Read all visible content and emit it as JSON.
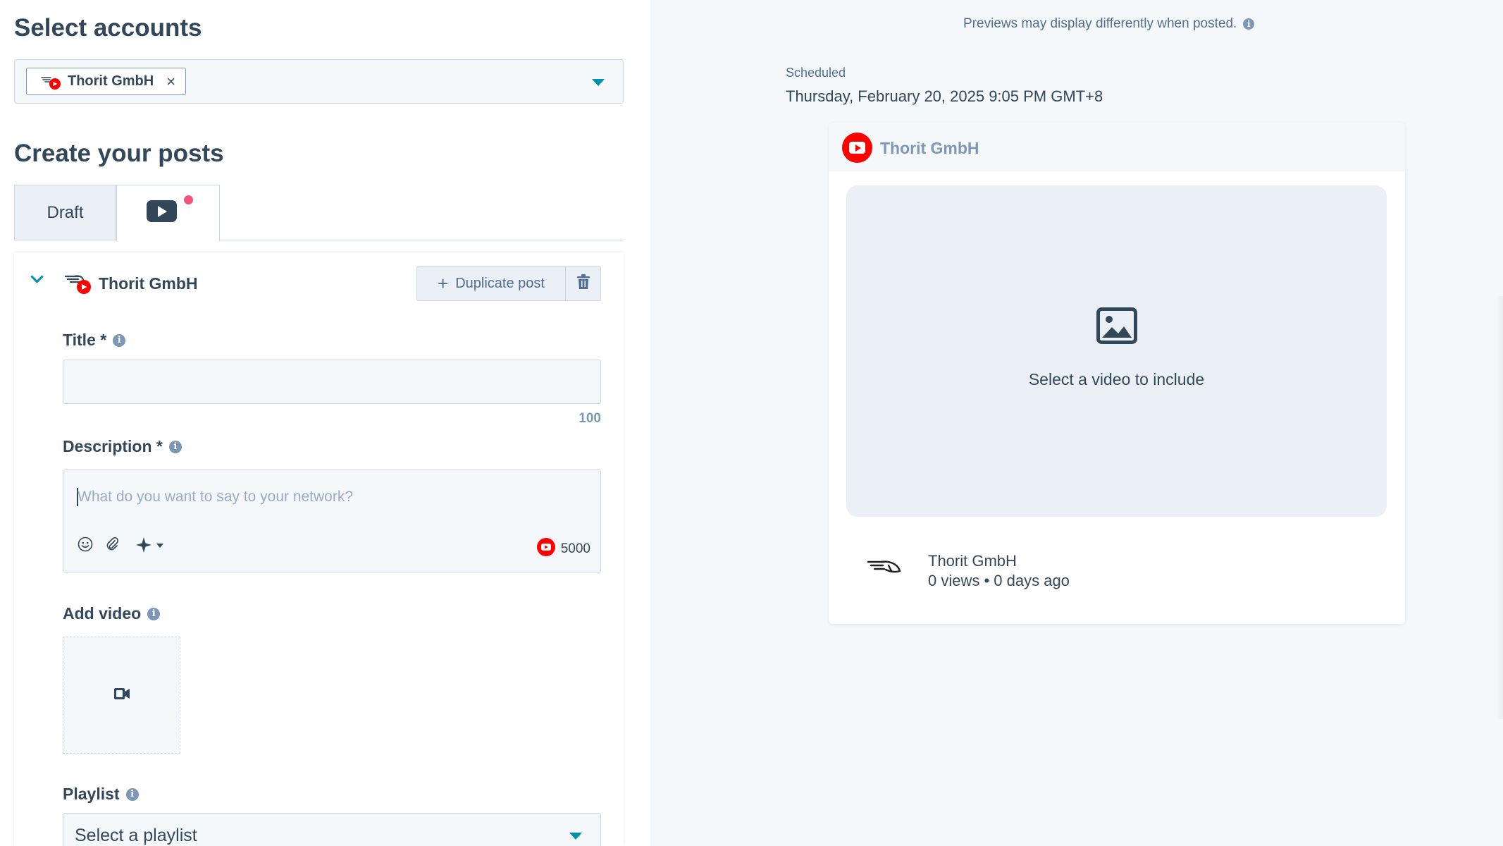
{
  "select_accounts": {
    "heading": "Select accounts",
    "selected": [
      {
        "name": "Thorit GmbH",
        "remove_label": "×"
      }
    ]
  },
  "create_posts": {
    "heading": "Create your posts",
    "tabs": [
      {
        "label": "Draft"
      },
      {
        "network": "youtube",
        "icon": "youtube-icon",
        "has_alert_dot": true
      }
    ]
  },
  "post": {
    "account_name": "Thorit GmbH",
    "duplicate_label": "Duplicate post",
    "duplicate_icon": "+",
    "title": {
      "label": "Title *",
      "info": "i",
      "value": "",
      "char_limit": "100"
    },
    "description": {
      "label": "Description *",
      "info": "i",
      "placeholder": "What do you want to say to your network?",
      "char_limit": "5000"
    },
    "add_video": {
      "label": "Add video",
      "info": "i"
    },
    "playlist": {
      "label": "Playlist",
      "info": "i",
      "value": "Select a playlist"
    }
  },
  "preview": {
    "note": "Previews may display differently when posted.",
    "info": "i",
    "scheduled_label": "Scheduled",
    "scheduled_value": "Thursday, February 20, 2025 9:05 PM GMT+8",
    "account_name": "Thorit GmbH",
    "media_placeholder": "Select a video to include",
    "footer_name": "Thorit GmbH",
    "footer_stats": "0 views • 0 days ago"
  },
  "colors": {
    "text": "#33475b",
    "accent": "#0091ae",
    "youtube_red": "#ff0000",
    "alert_dot": "#f2547d",
    "muted": "#7c98b6"
  }
}
